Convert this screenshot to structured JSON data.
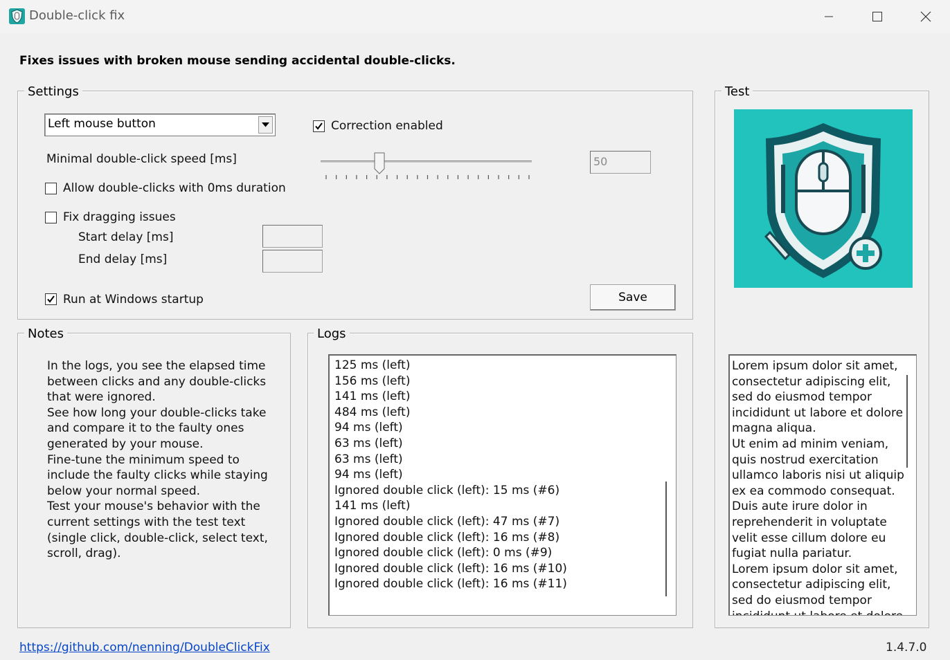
{
  "window": {
    "title": "Double-click fix",
    "icon": "shield-mouse-icon",
    "controls": [
      "minimize-icon",
      "maximize-icon",
      "close-icon"
    ]
  },
  "subtitle": "Fixes issues with broken mouse sending accidental double-clicks.",
  "settings": {
    "legend": "Settings",
    "mouse_button_select": "Left mouse button",
    "correction_enabled_label": "Correction enabled",
    "correction_enabled": true,
    "min_speed_label": "Minimal double-click speed [ms]",
    "min_speed_value": "50",
    "slider_fraction": 0.28,
    "allow_zero_label": "Allow double-clicks with 0ms duration",
    "allow_zero": false,
    "fix_dragging_label": "Fix dragging issues",
    "fix_dragging": false,
    "start_delay_label": "Start delay [ms]",
    "start_delay_value": "",
    "end_delay_label": "End delay [ms]",
    "end_delay_value": "",
    "run_startup_label": "Run at Windows startup",
    "run_startup": true,
    "save_label": "Save"
  },
  "test": {
    "legend": "Test",
    "text": "Lorem ipsum dolor sit amet,\nconsectetur adipiscing elit,\nsed do eiusmod tempor\nincididunt ut labore et dolore\nmagna aliqua.\nUt enim ad minim veniam,\nquis nostrud exercitation\nullamco laboris nisi ut aliquip\nex ea commodo consequat.\nDuis aute irure dolor in\nreprehenderit in voluptate\nvelit esse cillum dolore eu\nfugiat nulla pariatur.\n Lorem ipsum dolor sit amet,\nconsectetur adipiscing elit,\nsed do eiusmod tempor\nincididunt ut labore et dolore"
  },
  "notes": {
    "legend": "Notes",
    "text": "In the logs, you see the elapsed time\nbetween clicks and any double-clicks\nthat were ignored.\nSee how long your double-clicks take\nand compare it to the faulty ones\ngenerated by your mouse.\nFine-tune the minimum speed to\ninclude the faulty clicks while staying\nbelow your normal speed.\nTest your mouse's behavior with the\ncurrent settings with the test text\n(single click, double-click, select text,\nscroll, drag)."
  },
  "logs": {
    "legend": "Logs",
    "lines": [
      "125 ms (left)",
      "156 ms (left)",
      "141 ms (left)",
      "484 ms (left)",
      "94 ms (left)",
      "63 ms (left)",
      "63 ms (left)",
      "94 ms (left)",
      "Ignored double click (left): 15 ms (#6)",
      "141 ms (left)",
      "Ignored double click (left): 47 ms (#7)",
      "Ignored double click (left): 16 ms (#8)",
      "Ignored double click (left): 0 ms (#9)",
      "Ignored double click (left): 16 ms (#10)",
      "Ignored double click (left): 16 ms (#11)"
    ]
  },
  "footer": {
    "link": "https://github.com/nenning/DoubleClickFix",
    "version": "1.4.7.0"
  },
  "colors": {
    "logo_bg": "#22c3bd",
    "link": "#0645c8"
  }
}
